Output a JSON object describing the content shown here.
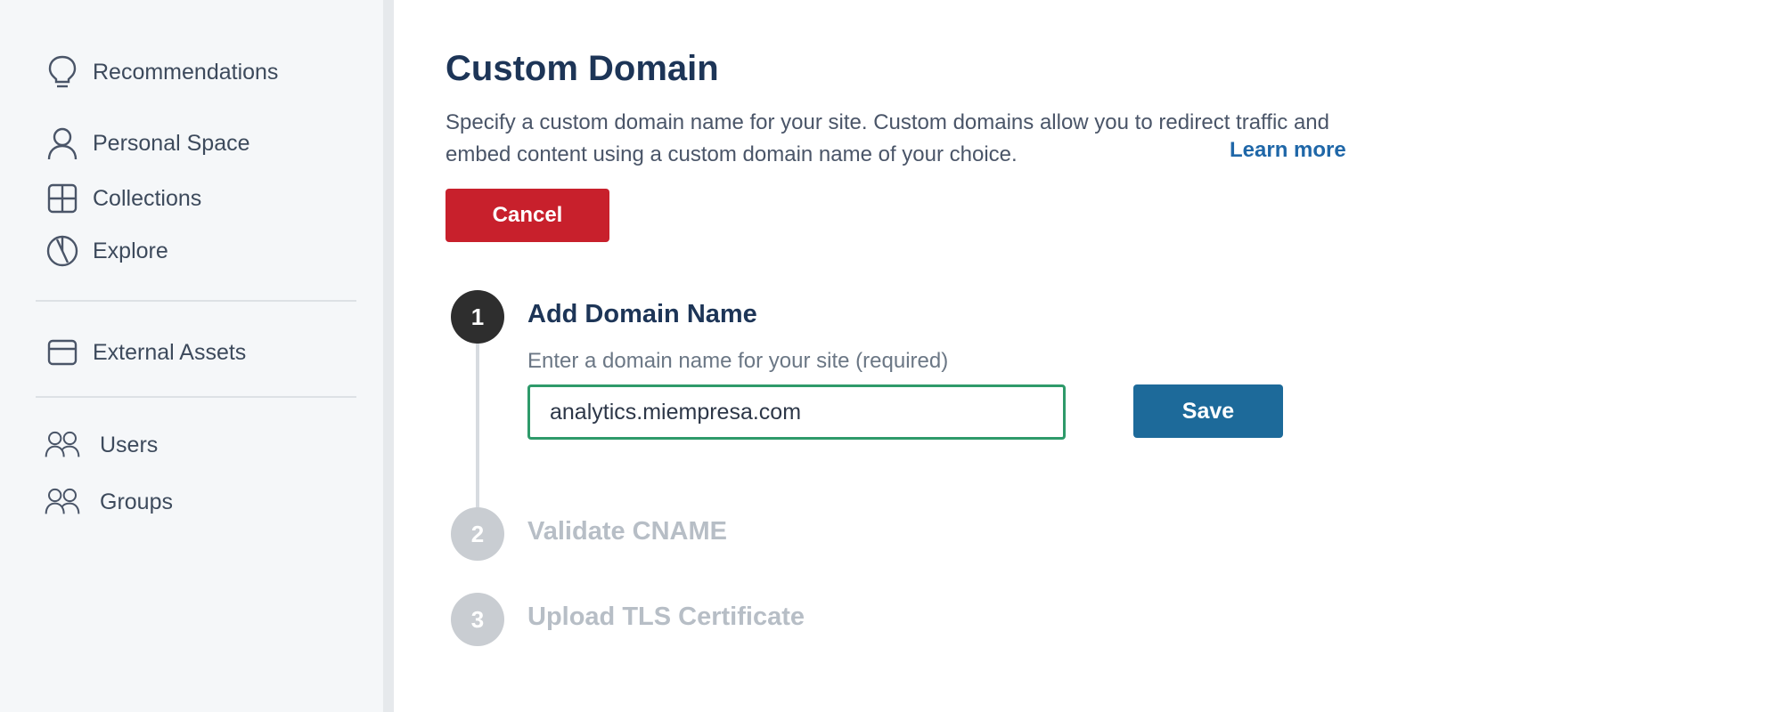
{
  "sidebar": {
    "items": [
      {
        "label": "Recommendations",
        "icon": "lightbulb-icon"
      },
      {
        "label": "Personal Space",
        "icon": "user-icon"
      },
      {
        "label": "Collections",
        "icon": "grid-icon"
      },
      {
        "label": "Explore",
        "icon": "compass-icon"
      },
      {
        "label": "External Assets",
        "icon": "card-icon"
      },
      {
        "label": "Users",
        "icon": "users-icon"
      },
      {
        "label": "Groups",
        "icon": "groups-icon"
      }
    ]
  },
  "page": {
    "title": "Custom Domain",
    "description": "Specify a custom domain name for your site. Custom domains allow you to redirect traffic and embed content using a custom domain name of your choice.",
    "learn_more": "Learn more",
    "cancel_label": "Cancel"
  },
  "steps": [
    {
      "number": "1",
      "title": "Add Domain Name",
      "state": "active"
    },
    {
      "number": "2",
      "title": "Validate CNAME",
      "state": "inactive"
    },
    {
      "number": "3",
      "title": "Upload TLS Certificate",
      "state": "inactive"
    }
  ],
  "domain_form": {
    "label": "Enter a domain name for your site (required)",
    "value": "analytics.miempresa.com",
    "save_label": "Save"
  },
  "colors": {
    "primary_text": "#1d3557",
    "cancel": "#c8202c",
    "save": "#1d6a9a",
    "input_focus": "#2e9a6a",
    "link": "#1f67a8"
  }
}
